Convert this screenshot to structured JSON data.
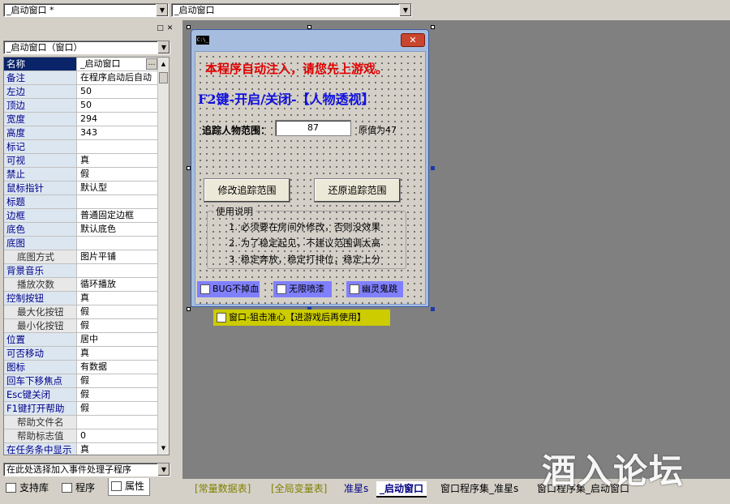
{
  "top_bar": {
    "left_combo_value": "_启动窗口 *",
    "right_combo_value": "_启动窗口"
  },
  "panel": {
    "object_selector": "_启动窗口（窗口）",
    "properties": [
      {
        "k": "名称",
        "v": "_启动窗口",
        "sel": true
      },
      {
        "k": "备注",
        "v": "在程序启动后自动"
      },
      {
        "k": "左边",
        "v": "50"
      },
      {
        "k": "顶边",
        "v": "50"
      },
      {
        "k": "宽度",
        "v": "294"
      },
      {
        "k": "高度",
        "v": "343"
      },
      {
        "k": "标记",
        "v": ""
      },
      {
        "k": "可视",
        "v": "真"
      },
      {
        "k": "禁止",
        "v": "假"
      },
      {
        "k": "鼠标指针",
        "v": "默认型"
      },
      {
        "k": "标题",
        "v": ""
      },
      {
        "k": "边框",
        "v": "普通固定边框"
      },
      {
        "k": "底色",
        "v": "默认底色"
      },
      {
        "k": "底图",
        "v": ""
      },
      {
        "k": "底图方式",
        "v": "图片平铺",
        "sub": true
      },
      {
        "k": "背景音乐",
        "v": ""
      },
      {
        "k": "播放次数",
        "v": "循环播放",
        "sub": true
      },
      {
        "k": "控制按钮",
        "v": "真"
      },
      {
        "k": "最大化按钮",
        "v": "假",
        "sub": true
      },
      {
        "k": "最小化按钮",
        "v": "假",
        "sub": true
      },
      {
        "k": "位置",
        "v": "居中"
      },
      {
        "k": "可否移动",
        "v": "真"
      },
      {
        "k": "图标",
        "v": "有数据"
      },
      {
        "k": "回车下移焦点",
        "v": "假"
      },
      {
        "k": "Esc键关闭",
        "v": "假"
      },
      {
        "k": "F1键打开帮助",
        "v": "假"
      },
      {
        "k": "帮助文件名",
        "v": "",
        "sub": true
      },
      {
        "k": "帮助标志值",
        "v": "0",
        "sub": true
      },
      {
        "k": "在任务条中显示",
        "v": "真"
      }
    ],
    "event_combo": "在此处选择加入事件处理子程序",
    "bottom_tabs": [
      "支持库",
      "程序",
      "属性"
    ]
  },
  "design_window": {
    "sys_icon": "C:\\_",
    "close_label": "✕",
    "notice": "本程序自动注入，请您先上游戏。",
    "hotkey_title": "F2键-开启/关闭-【人物透视】",
    "range_label": "追踪人物范围：",
    "range_value": "87",
    "original_label": "原值为47",
    "btn_modify": "修改追踪范围",
    "btn_restore": "还原追踪范围",
    "instructions_title": "使用说明",
    "instructions": [
      "1. 必须要在房间外修改，否则没效果",
      "2. 为了稳定起见，不建议范围调太高",
      "3. 稳定奔放，稳定打排位，稳定上分"
    ],
    "chk_bug": "BUG不掉血",
    "chk_spray": "无限喷漆",
    "chk_ghost": "幽灵鬼跳",
    "chk_sniper": "窗口-狙击准心【进游戏后再使用】",
    "colors": {
      "notice": "#e00000",
      "hotkey_title": "#1010e0",
      "checkbox_bg": "#8080ff",
      "sniper_bg": "#cccc00"
    }
  },
  "tabs": [
    {
      "label": "[常量数据表]",
      "color": "#808000"
    },
    {
      "label": "[全局变量表]",
      "color": "#808000"
    },
    {
      "label": "准星s",
      "color": "#000080"
    },
    {
      "label": "_启动窗口",
      "color": "#000080",
      "active": true
    },
    {
      "label": "窗口程序集_准星s",
      "color": "#000000"
    },
    {
      "label": "窗口程序集_启动窗口",
      "color": "#000000"
    }
  ],
  "watermark": "酒入论坛"
}
